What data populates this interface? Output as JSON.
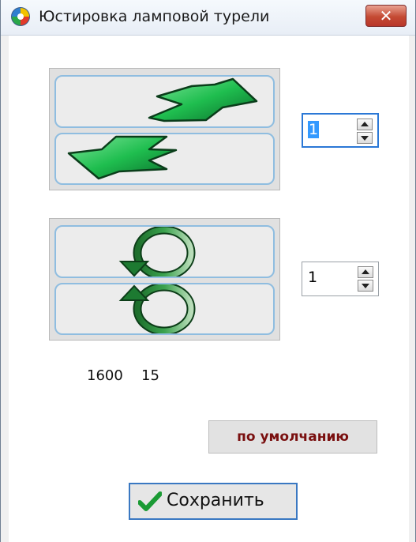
{
  "window": {
    "title": "Юстировка ламповой турели",
    "close_glyph": "✕",
    "icon": "app-icon"
  },
  "move_group": {
    "forward_icon": "arrow-right-up-icon",
    "backward_icon": "arrow-left-down-icon",
    "step_value": "1"
  },
  "rotate_group": {
    "cw_icon": "rotate-arrow-down-icon",
    "ccw_icon": "rotate-arrow-up-icon",
    "step_value": "1"
  },
  "status": {
    "position": "1600",
    "angle": "15"
  },
  "buttons": {
    "default_label": "по умолчанию",
    "save_label": "Сохранить",
    "save_icon": "checkmark-icon"
  },
  "colors": {
    "arrow_green": "#1fbe4f",
    "rotate_green": "#2f8f3f",
    "default_text": "#7a1010",
    "focus_blue": "#2b78d6"
  }
}
